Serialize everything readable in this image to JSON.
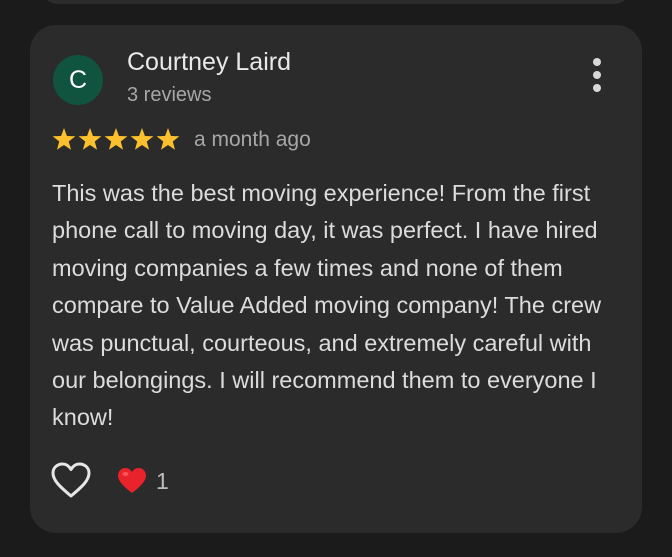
{
  "review": {
    "avatar_initial": "C",
    "avatar_color": "#10533e",
    "reviewer_name": "Courtney Laird",
    "review_count": "3 reviews",
    "rating": 5,
    "rating_max": 5,
    "star_color": "#fbc02d",
    "date": "a month ago",
    "text": "This was the best moving experience! From the first phone call to moving day, it was perfect. I have hired moving companies a few times and none of them compare to Value Added moving company! The crew was punctual, courteous, and extremely careful with our belongings. I will recommend them to everyone I know!",
    "more_icon": "more-vert-icon",
    "like_icon": "heart-outline-icon",
    "reaction_icon": "red-heart-icon",
    "reaction_count": "1"
  }
}
